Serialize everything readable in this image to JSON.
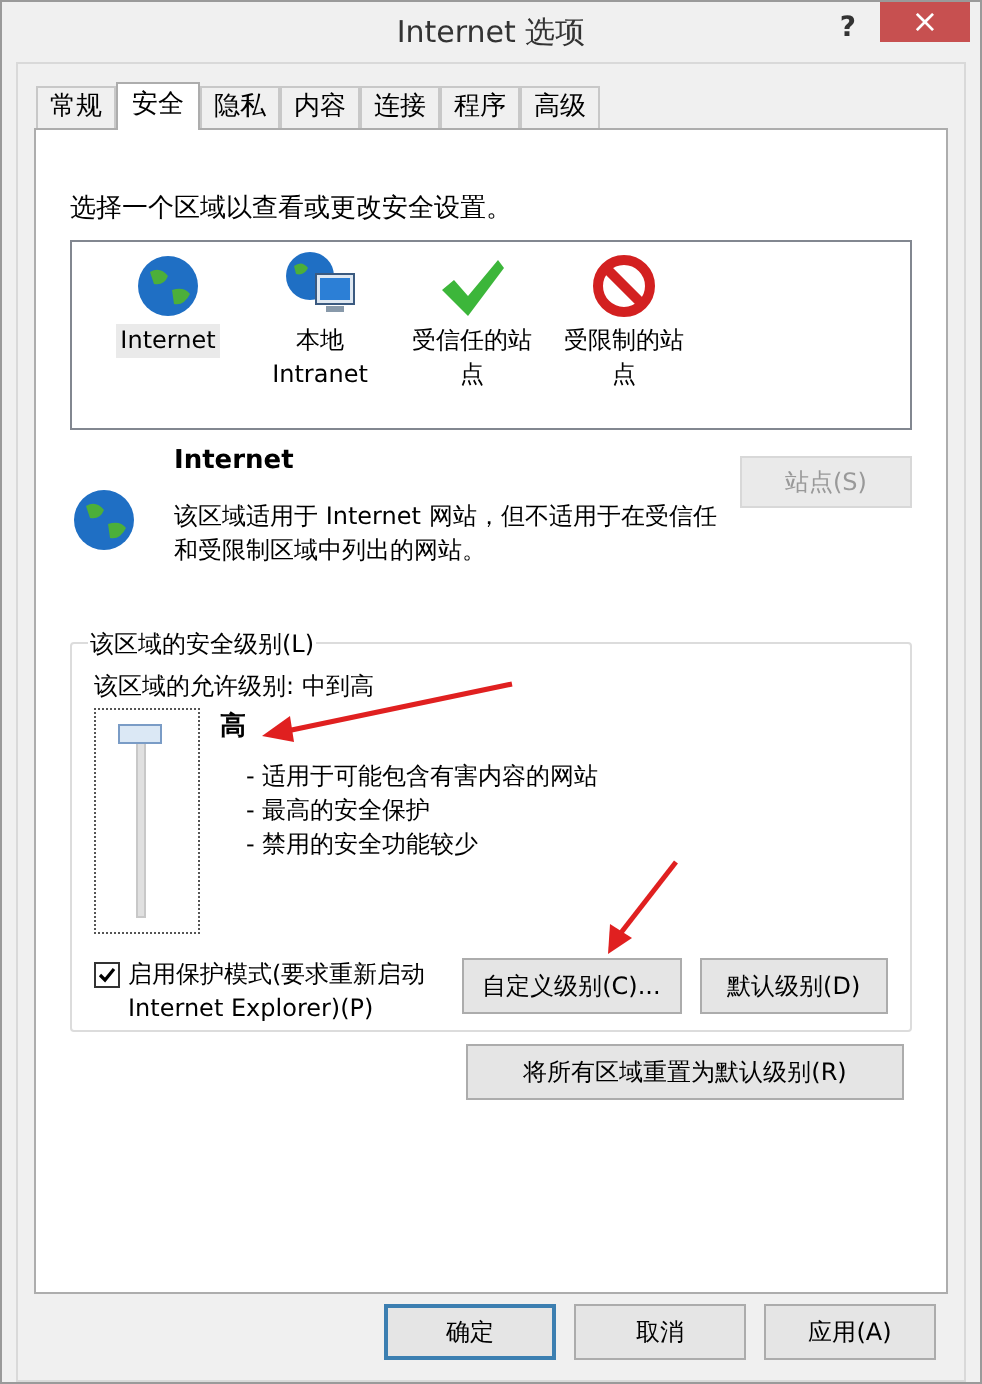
{
  "window": {
    "title": "Internet 选项",
    "help": "?",
    "close": "×"
  },
  "tabs": [
    {
      "label": "常规",
      "selected": false
    },
    {
      "label": "安全",
      "selected": true
    },
    {
      "label": "隐私",
      "selected": false
    },
    {
      "label": "内容",
      "selected": false
    },
    {
      "label": "连接",
      "selected": false
    },
    {
      "label": "程序",
      "selected": false
    },
    {
      "label": "高级",
      "selected": false
    }
  ],
  "zone_prompt": "选择一个区域以查看或更改安全设置。",
  "zones": [
    {
      "kind": "globe",
      "label": "Internet",
      "selected": true
    },
    {
      "kind": "intranet",
      "label": "本地 Intranet",
      "selected": false
    },
    {
      "kind": "trusted",
      "label": "受信任的站点",
      "selected": false
    },
    {
      "kind": "restricted",
      "label": "受限制的站点",
      "selected": false
    }
  ],
  "zone_info": {
    "title": "Internet",
    "description": "该区域适用于 Internet 网站，但不适用于在受信任和受限制区域中列出的网站。",
    "sites_button": {
      "label": "站点(S)",
      "disabled": true
    }
  },
  "security_level": {
    "group_title": "该区域的安全级别(L)",
    "allowed": "该区域的允许级别: 中到高",
    "level": 1,
    "level_name": "高",
    "bullets": [
      "- 适用于可能包含有害内容的网站",
      "- 最高的安全保护",
      "- 禁用的安全功能较少"
    ],
    "protected_mode": {
      "label": "启用保护模式(要求重新启动 Internet Explorer)(P)",
      "checked": true
    },
    "custom_button": "自定义级别(C)...",
    "default_button": "默认级别(D)"
  },
  "reset_button": "将所有区域重置为默认级别(R)",
  "buttons": [
    {
      "label": "确定",
      "default": true
    },
    {
      "label": "取消",
      "default": false
    },
    {
      "label": "应用(A)",
      "default": false
    }
  ]
}
